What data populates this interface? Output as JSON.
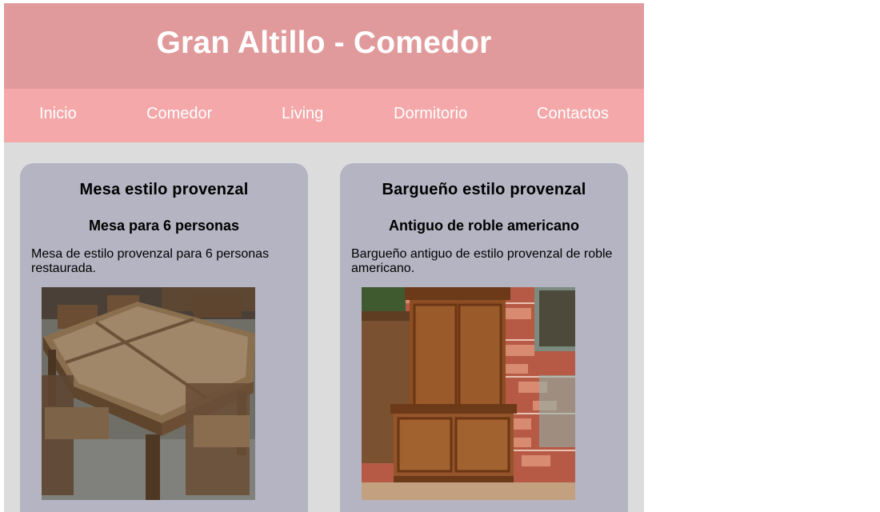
{
  "site": {
    "title": "Gran Altillo - Comedor"
  },
  "nav": {
    "items": [
      {
        "label": "Inicio"
      },
      {
        "label": "Comedor"
      },
      {
        "label": "Living"
      },
      {
        "label": "Dormitorio"
      },
      {
        "label": "Contactos"
      }
    ]
  },
  "products": [
    {
      "title": "Mesa estilo provenzal",
      "subtitle": "Mesa para 6 personas",
      "description": "Mesa de estilo provenzal para 6 personas restaurada."
    },
    {
      "title": "Bargueño estilo provenzal",
      "subtitle": "Antiguo de roble americano",
      "description": "Bargueño antiguo de estilo provenzal de roble americano."
    }
  ],
  "colors": {
    "header_bg": "#e19a9b",
    "nav_bg": "#f4a8a9",
    "content_bg": "#dcdcdc",
    "card_bg": "#b4b4c3",
    "header_text": "#ffffff"
  }
}
